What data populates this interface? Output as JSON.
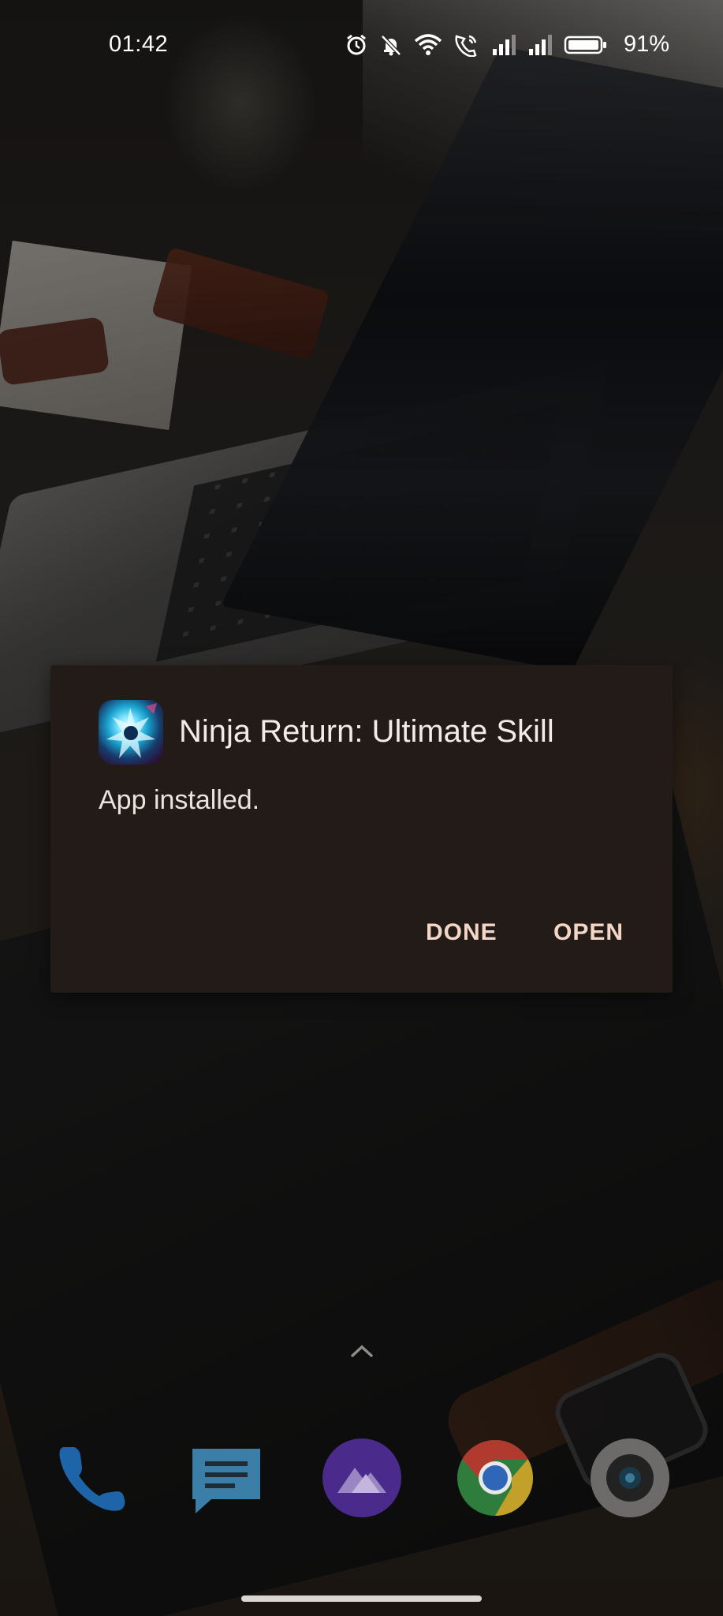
{
  "status_bar": {
    "time": "01:42",
    "battery_percent": "91%",
    "icons": [
      "alarm-icon",
      "bell-muted-icon",
      "wifi-icon",
      "wifi-calling-icon",
      "signal-icon",
      "signal-icon",
      "battery-icon"
    ]
  },
  "dialog": {
    "app_name": "Ninja Return: Ultimate Skill",
    "message": "App installed.",
    "done_label": "DONE",
    "open_label": "OPEN",
    "accent_color": "#f3d6c6",
    "background_color": "#221b18"
  },
  "dock": {
    "apps": [
      "phone-icon",
      "messages-icon",
      "gallery-icon",
      "chrome-icon",
      "camera-icon"
    ]
  }
}
